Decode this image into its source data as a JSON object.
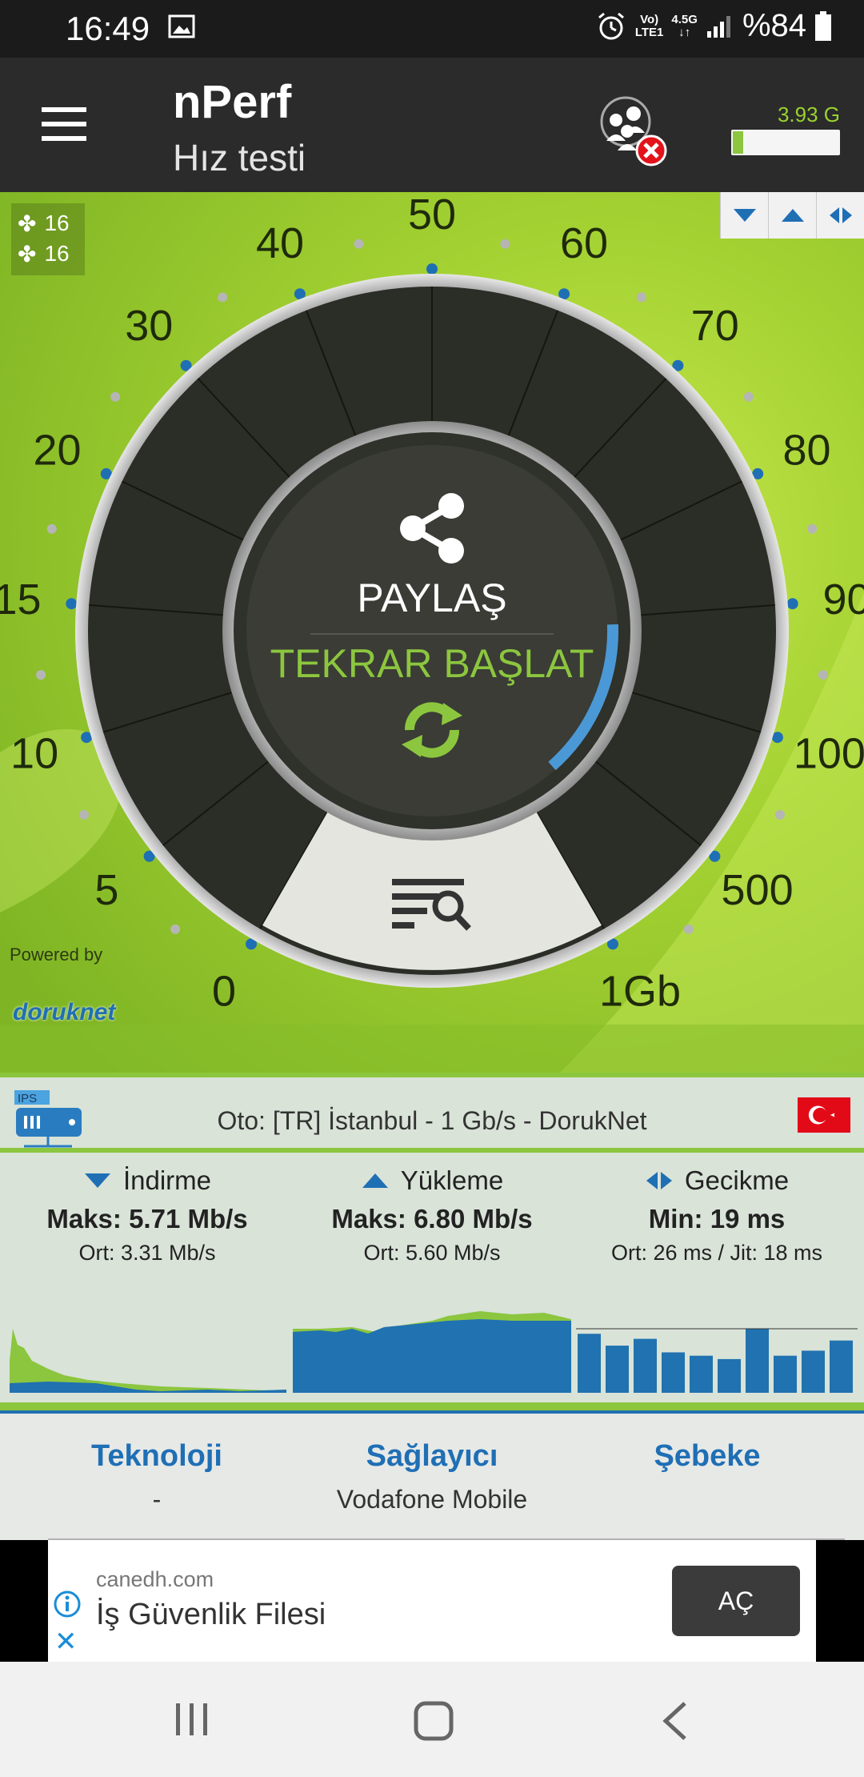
{
  "status_bar": {
    "time": "16:49",
    "network_line1": "Vo)",
    "network_line2": "LTE1",
    "network_type": "4.5G",
    "battery": "%84"
  },
  "app_bar": {
    "title": "nPerf",
    "subtitle": "Hız testi",
    "data_used": "3.93 G",
    "data_bar_fraction": 0.1
  },
  "servers": {
    "count_a": "16",
    "count_b": "16"
  },
  "gauge": {
    "scale_labels": [
      "0",
      "5",
      "10",
      "15",
      "20",
      "30",
      "40",
      "50",
      "60",
      "70",
      "80",
      "90",
      "100",
      "500",
      "1Gb"
    ],
    "share_label": "PAYLAŞ",
    "restart_label": "TEKRAR BAŞLAT",
    "progress_fraction": 0.14,
    "powered_by": "Powered by",
    "sponsor": "doruknet",
    "icons": [
      "share-icon",
      "refresh-icon",
      "results-list-icon"
    ]
  },
  "server_info": {
    "badge": "IPS",
    "text": "Oto: [TR] İstanbul - 1 Gb/s - DorukNet"
  },
  "results": {
    "download": {
      "label": "İndirme",
      "max": "Maks: 5.71 Mb/s",
      "avg": "Ort: 3.31 Mb/s"
    },
    "upload": {
      "label": "Yükleme",
      "max": "Maks: 6.80 Mb/s",
      "avg": "Ort: 5.60 Mb/s"
    },
    "latency": {
      "label": "Gecikme",
      "min": "Min: 19 ms",
      "avg": "Ort: 26 ms / Jit: 18 ms"
    },
    "latency_bars": [
      70,
      56,
      64,
      48,
      44,
      40,
      76,
      44,
      50,
      62
    ]
  },
  "network": {
    "technology": {
      "label": "Teknoloji",
      "value": "-"
    },
    "provider": {
      "label": "Sağlayıcı",
      "value": "Vodafone Mobile"
    },
    "network": {
      "label": "Şebeke",
      "value": ""
    }
  },
  "ad": {
    "domain": "canedh.com",
    "title": "İş Güvenlik Filesi",
    "button": "AÇ"
  },
  "colors": {
    "accent_green": "#8cc63f",
    "accent_blue": "#1f6fb5",
    "bar_blue": "#2072b0",
    "dark": "#2b2b2b"
  }
}
